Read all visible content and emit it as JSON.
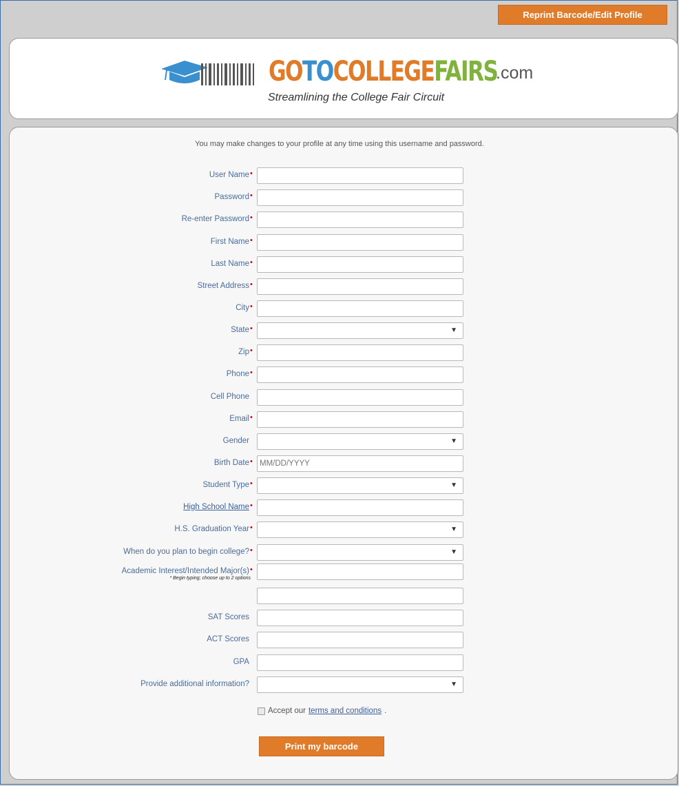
{
  "header": {
    "reprint_button": "Reprint Barcode/Edit Profile",
    "logo": {
      "part1": "GO",
      "part2": "TO",
      "part3": "COLLEGE",
      "part4": "FAIRS",
      "suffix": ".com"
    },
    "tagline": "Streamlining the College Fair Circuit"
  },
  "form": {
    "intro": "You may make changes to your profile at any time using this username and password.",
    "fields": {
      "user_name": "User Name",
      "password": "Password",
      "reenter_password": "Re-enter Password",
      "first_name": "First Name",
      "last_name": "Last Name",
      "street_address": "Street Address",
      "city": "City",
      "state": "State",
      "zip": "Zip",
      "phone": "Phone",
      "cell_phone": "Cell Phone",
      "email": "Email",
      "gender": "Gender",
      "birth_date": "Birth Date",
      "birth_date_placeholder": "MM/DD/YYYY",
      "student_type": "Student Type",
      "high_school_name": "High School Name",
      "hs_graduation_year": "H.S. Graduation Year",
      "begin_college": "When do you plan to begin college?",
      "academic_interest": "Academic Interest/Intended Major(s)",
      "academic_hint": "* Begin typing; choose up to 2 options",
      "sat_scores": "SAT Scores",
      "act_scores": "ACT Scores",
      "gpa": "GPA",
      "additional_info": "Provide additional information?"
    },
    "terms_prefix": "Accept our",
    "terms_link": "terms and conditions",
    "terms_suffix": ".",
    "required_mark": "•",
    "print_button": "Print my barcode"
  }
}
